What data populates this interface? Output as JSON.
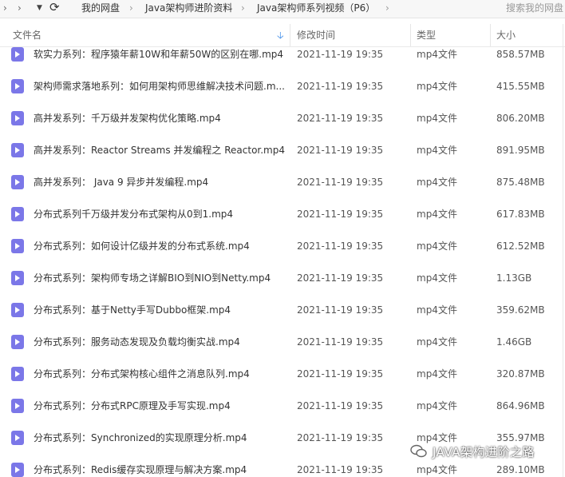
{
  "toolbar": {
    "breadcrumb": [
      "我的网盘",
      "Java架构师进阶资料",
      "Java架构师系列视频（P6）"
    ],
    "search_placeholder": "搜索我的网盘"
  },
  "columns": {
    "name": "文件名",
    "modified": "修改时间",
    "type": "类型",
    "size": "大小"
  },
  "files": [
    {
      "name": "软实力系列：程序猿年薪10W和年薪50W的区别在哪.mp4",
      "modified": "2021-11-19 19:35",
      "type": "mp4文件",
      "size": "858.57MB"
    },
    {
      "name": "架构师需求落地系列：如何用架构师思维解决技术问题.m...",
      "modified": "2021-11-19 19:35",
      "type": "mp4文件",
      "size": "415.55MB"
    },
    {
      "name": "高并发系列：千万级并发架构优化策略.mp4",
      "modified": "2021-11-19 19:35",
      "type": "mp4文件",
      "size": "806.20MB"
    },
    {
      "name": "高并发系列：Reactor Streams 并发编程之 Reactor.mp4",
      "modified": "2021-11-19 19:35",
      "type": "mp4文件",
      "size": "891.95MB"
    },
    {
      "name": "高并发系列： Java 9 异步并发编程.mp4",
      "modified": "2021-11-19 19:35",
      "type": "mp4文件",
      "size": "875.48MB"
    },
    {
      "name": "分布式系列千万级并发分布式架构从0到1.mp4",
      "modified": "2021-11-19 19:35",
      "type": "mp4文件",
      "size": "617.83MB"
    },
    {
      "name": "分布式系列：如何设计亿级并发的分布式系统.mp4",
      "modified": "2021-11-19 19:35",
      "type": "mp4文件",
      "size": "612.52MB"
    },
    {
      "name": "分布式系列：架构师专场之详解BIO到NIO到Netty.mp4",
      "modified": "2021-11-19 19:35",
      "type": "mp4文件",
      "size": "1.13GB"
    },
    {
      "name": "分布式系列：基于Netty手写Dubbo框架.mp4",
      "modified": "2021-11-19 19:35",
      "type": "mp4文件",
      "size": "359.62MB"
    },
    {
      "name": "分布式系列：服务动态发现及负载均衡实战.mp4",
      "modified": "2021-11-19 19:35",
      "type": "mp4文件",
      "size": "1.46GB"
    },
    {
      "name": "分布式系列：分布式架构核心组件之消息队列.mp4",
      "modified": "2021-11-19 19:35",
      "type": "mp4文件",
      "size": "320.87MB"
    },
    {
      "name": "分布式系列：分布式RPC原理及手写实现.mp4",
      "modified": "2021-11-19 19:35",
      "type": "mp4文件",
      "size": "864.96MB"
    },
    {
      "name": "分布式系列：Synchronized的实现原理分析.mp4",
      "modified": "2021-11-19 19:35",
      "type": "mp4文件",
      "size": "355.97MB"
    },
    {
      "name": "分布式系列：Redis缓存实现原理与解决方案.mp4",
      "modified": "2021-11-19 19:35",
      "type": "mp4文件",
      "size": "289.10MB"
    }
  ],
  "watermark": "JAVA架构进阶之路"
}
